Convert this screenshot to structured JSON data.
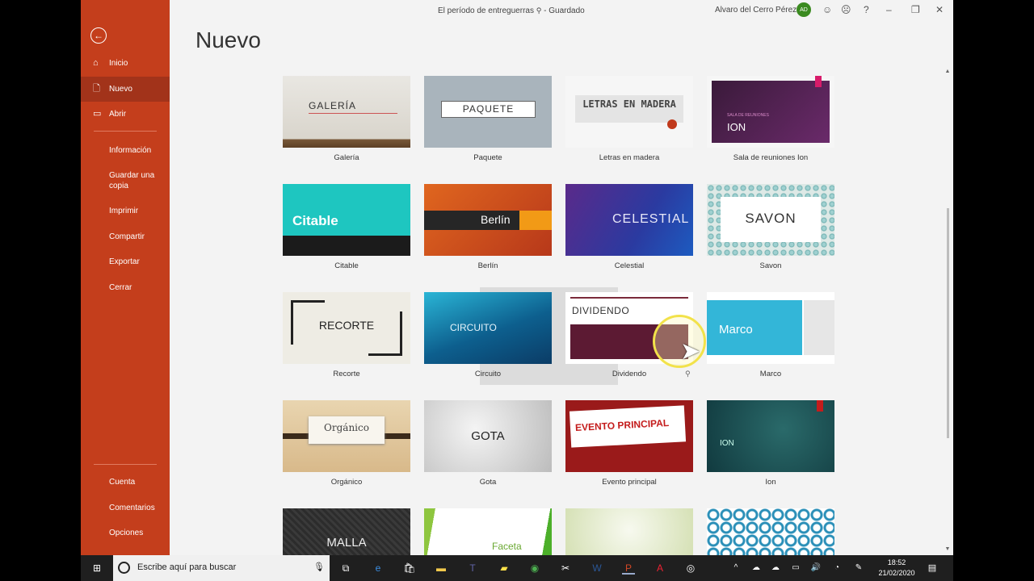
{
  "window": {
    "doc_title": "El período de entreguerras",
    "save_state": "Guardado",
    "user_name": "Alvaro del Cerro Pérez",
    "user_initials": "AD"
  },
  "sidebar": {
    "items": [
      {
        "label": "Inicio",
        "icon": "home-icon"
      },
      {
        "label": "Nuevo",
        "icon": "new-document-icon"
      },
      {
        "label": "Abrir",
        "icon": "folder-icon"
      },
      {
        "label": "Información"
      },
      {
        "label": "Guardar una copia"
      },
      {
        "label": "Imprimir"
      },
      {
        "label": "Compartir"
      },
      {
        "label": "Exportar"
      },
      {
        "label": "Cerrar"
      }
    ],
    "bottom_items": [
      {
        "label": "Cuenta"
      },
      {
        "label": "Comentarios"
      },
      {
        "label": "Opciones"
      }
    ]
  },
  "page": {
    "title": "Nuevo"
  },
  "templates": [
    {
      "name": "Galería",
      "thumb_text": "GALERÍA"
    },
    {
      "name": "Paquete",
      "thumb_text": "PAQUETE"
    },
    {
      "name": "Letras en madera",
      "thumb_text": "LETRAS EN MADERA"
    },
    {
      "name": "Sala de reuniones Ion",
      "thumb_text": "ION",
      "thumb_sub": "SALA DE REUNIONES"
    },
    {
      "name": "Citable",
      "thumb_text": "Citable"
    },
    {
      "name": "Berlín",
      "thumb_text": "Berlín"
    },
    {
      "name": "Celestial",
      "thumb_text": "CELESTIAL"
    },
    {
      "name": "Savon",
      "thumb_text": "SAVON"
    },
    {
      "name": "Recorte",
      "thumb_text": "RECORTE"
    },
    {
      "name": "Circuito",
      "thumb_text": "CIRCUITO"
    },
    {
      "name": "Dividendo",
      "thumb_text": "DIVIDENDO"
    },
    {
      "name": "Marco",
      "thumb_text": "Marco"
    },
    {
      "name": "Orgánico",
      "thumb_text": "Orgánico"
    },
    {
      "name": "Gota",
      "thumb_text": "GOTA"
    },
    {
      "name": "Evento principal",
      "thumb_text": "EVENTO PRINCIPAL"
    },
    {
      "name": "Ion",
      "thumb_text": "ION"
    },
    {
      "thumb_text": "MALLA"
    },
    {
      "thumb_text": "Faceta"
    },
    {
      "thumb_text": ""
    },
    {
      "thumb_text": ""
    }
  ],
  "taskbar": {
    "search_placeholder": "Escribe aquí para buscar",
    "time": "18:52",
    "date": "21/02/2020"
  },
  "colors": {
    "accent": "#c43e1c",
    "accent_dark": "#a2331a"
  }
}
